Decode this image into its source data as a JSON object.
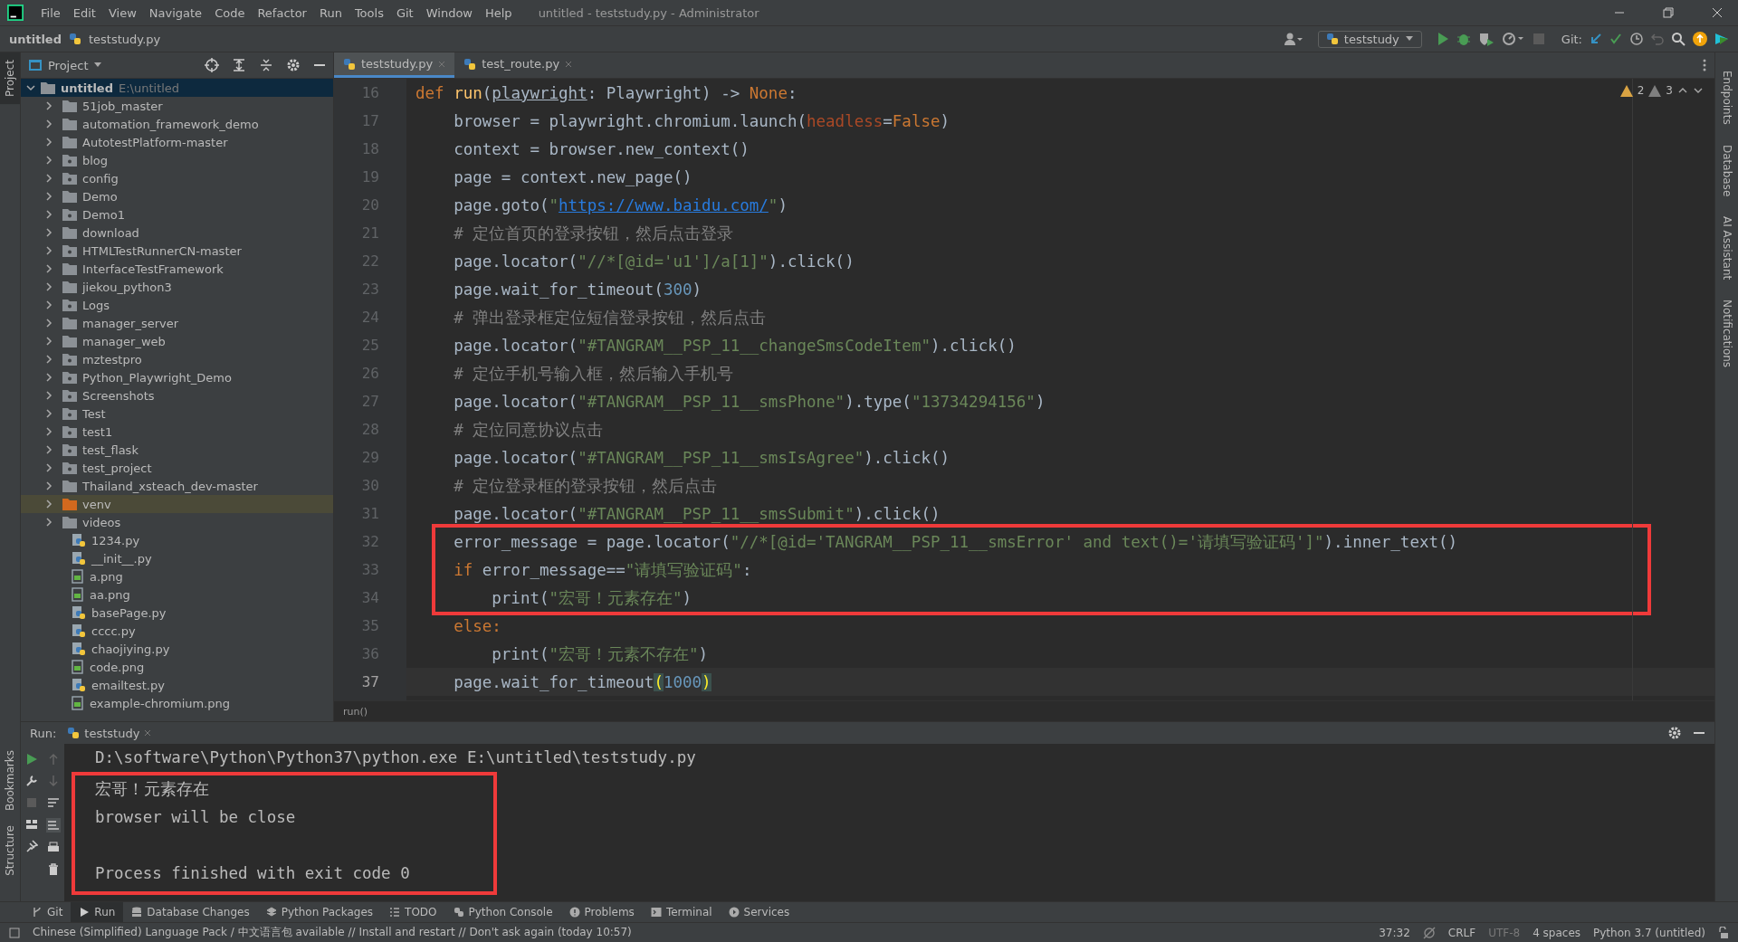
{
  "title_bar": {
    "menus": [
      "File",
      "Edit",
      "View",
      "Navigate",
      "Code",
      "Refactor",
      "Run",
      "Tools",
      "Git",
      "Window",
      "Help"
    ],
    "title": "untitled - teststudy.py - Administrator"
  },
  "nav_bar": {
    "breadcrumb": [
      "untitled",
      "teststudy.py"
    ],
    "run_config": "teststudy",
    "git_label": "Git:"
  },
  "left_stripe": {
    "top": [
      {
        "label": "Project",
        "selected": true
      }
    ],
    "bottom": [
      {
        "label": "Bookmarks",
        "selected": false
      },
      {
        "label": "Structure",
        "selected": false
      }
    ]
  },
  "project": {
    "title": "Project",
    "root": {
      "name": "untitled",
      "path": "E:\\untitled",
      "expanded": true,
      "children": [
        {
          "name": "51job_master",
          "kind": "folder",
          "expanded": false,
          "selected": false
        },
        {
          "name": "automation_framework_demo",
          "kind": "folder",
          "expanded": false,
          "selected": false
        },
        {
          "name": "AutotestPlatform-master",
          "kind": "folder",
          "expanded": false,
          "selected": false
        },
        {
          "name": "blog",
          "kind": "package",
          "expanded": false,
          "selected": false
        },
        {
          "name": "config",
          "kind": "package",
          "expanded": false,
          "selected": false
        },
        {
          "name": "Demo",
          "kind": "folder",
          "expanded": false,
          "selected": false
        },
        {
          "name": "Demo1",
          "kind": "package",
          "expanded": false,
          "selected": false
        },
        {
          "name": "download",
          "kind": "folder",
          "expanded": false,
          "selected": false
        },
        {
          "name": "HTMLTestRunnerCN-master",
          "kind": "package",
          "expanded": false,
          "selected": false
        },
        {
          "name": "InterfaceTestFramework",
          "kind": "folder",
          "expanded": false,
          "selected": false
        },
        {
          "name": "jiekou_python3",
          "kind": "folder",
          "expanded": false,
          "selected": false
        },
        {
          "name": "Logs",
          "kind": "package",
          "expanded": false,
          "selected": false
        },
        {
          "name": "manager_server",
          "kind": "folder",
          "expanded": false,
          "selected": false
        },
        {
          "name": "manager_web",
          "kind": "folder",
          "expanded": false,
          "selected": false
        },
        {
          "name": "mztestpro",
          "kind": "package",
          "expanded": false,
          "selected": false
        },
        {
          "name": "Python_Playwright_Demo",
          "kind": "package",
          "expanded": false,
          "selected": false
        },
        {
          "name": "Screenshots",
          "kind": "package",
          "expanded": false,
          "selected": false
        },
        {
          "name": "Test",
          "kind": "package",
          "expanded": false,
          "selected": false
        },
        {
          "name": "test1",
          "kind": "package",
          "expanded": false,
          "selected": false
        },
        {
          "name": "test_flask",
          "kind": "package",
          "expanded": false,
          "selected": false
        },
        {
          "name": "test_project",
          "kind": "package",
          "expanded": false,
          "selected": false
        },
        {
          "name": "Thailand_xsteach_dev-master",
          "kind": "folder",
          "expanded": false,
          "selected": false
        },
        {
          "name": "venv",
          "kind": "excluded",
          "expanded": false,
          "selected": true
        },
        {
          "name": "videos",
          "kind": "folder",
          "expanded": false,
          "selected": false
        },
        {
          "name": "1234.py",
          "kind": "python",
          "selected": false
        },
        {
          "name": "__init__.py",
          "kind": "python",
          "selected": false
        },
        {
          "name": "a.png",
          "kind": "image",
          "selected": false
        },
        {
          "name": "aa.png",
          "kind": "image",
          "selected": false
        },
        {
          "name": "basePage.py",
          "kind": "python",
          "selected": false
        },
        {
          "name": "cccc.py",
          "kind": "python",
          "selected": false
        },
        {
          "name": "chaojiying.py",
          "kind": "python",
          "selected": false
        },
        {
          "name": "code.png",
          "kind": "image",
          "selected": false
        },
        {
          "name": "emailtest.py",
          "kind": "python",
          "selected": false
        },
        {
          "name": "example-chromium.png",
          "kind": "image",
          "selected": false
        }
      ]
    }
  },
  "editor": {
    "tabs": [
      {
        "label": "teststudy.py",
        "selected": true
      },
      {
        "label": "test_route.py",
        "selected": false
      }
    ],
    "inspections": {
      "warnings": "2",
      "weak_warnings": "3"
    },
    "blocks": [
      {
        "boxed": false,
        "lines": [
          {
            "num": "16",
            "current": false,
            "tokens": [
              {
                "text": "def ",
                "kind": "keyword"
              },
              {
                "text": "run",
                "kind": "function"
              },
              {
                "text": "(",
                "kind": "plain"
              },
              {
                "text": "playwright",
                "kind": "underlined"
              },
              {
                "text": ": Playwright) -> ",
                "kind": "plain"
              },
              {
                "text": "None",
                "kind": "keyword"
              },
              {
                "text": ":",
                "kind": "plain"
              }
            ]
          },
          {
            "num": "17",
            "current": false,
            "tokens": [
              {
                "text": "    browser = playwright.chromium.launch(",
                "kind": "plain"
              },
              {
                "text": "headless",
                "kind": "argument"
              },
              {
                "text": "=",
                "kind": "plain"
              },
              {
                "text": "False",
                "kind": "keyword"
              },
              {
                "text": ")",
                "kind": "plain"
              }
            ]
          },
          {
            "num": "18",
            "current": false,
            "tokens": [
              {
                "text": "    context = browser.new_context()",
                "kind": "plain"
              }
            ]
          },
          {
            "num": "19",
            "current": false,
            "tokens": [
              {
                "text": "    page = context.new_page()",
                "kind": "plain"
              }
            ]
          },
          {
            "num": "20",
            "current": false,
            "tokens": [
              {
                "text": "    page.goto(",
                "kind": "plain"
              },
              {
                "text": "\"",
                "kind": "string"
              },
              {
                "text": "https://www.baidu.com/",
                "kind": "link"
              },
              {
                "text": "\"",
                "kind": "string"
              },
              {
                "text": ")",
                "kind": "plain"
              }
            ]
          },
          {
            "num": "21",
            "current": false,
            "tokens": [
              {
                "text": "    # 定位首页的登录按钮，然后点击登录",
                "kind": "comment"
              }
            ]
          },
          {
            "num": "22",
            "current": false,
            "tokens": [
              {
                "text": "    page.locator(",
                "kind": "plain"
              },
              {
                "text": "\"//*[@id='u1']/a[1]\"",
                "kind": "string"
              },
              {
                "text": ").click()",
                "kind": "plain"
              }
            ]
          },
          {
            "num": "23",
            "current": false,
            "tokens": [
              {
                "text": "    page.wait_for_timeout(",
                "kind": "plain"
              },
              {
                "text": "300",
                "kind": "number"
              },
              {
                "text": ")",
                "kind": "plain"
              }
            ]
          },
          {
            "num": "24",
            "current": false,
            "tokens": [
              {
                "text": "    # 弹出登录框定位短信登录按钮，然后点击",
                "kind": "comment"
              }
            ]
          },
          {
            "num": "25",
            "current": false,
            "tokens": [
              {
                "text": "    page.locator(",
                "kind": "plain"
              },
              {
                "text": "\"#TANGRAM__PSP_11__changeSmsCodeItem\"",
                "kind": "string"
              },
              {
                "text": ").click()",
                "kind": "plain"
              }
            ]
          },
          {
            "num": "26",
            "current": false,
            "tokens": [
              {
                "text": "    # 定位手机号输入框，然后输入手机号",
                "kind": "comment"
              }
            ]
          },
          {
            "num": "27",
            "current": false,
            "tokens": [
              {
                "text": "    page.locator(",
                "kind": "plain"
              },
              {
                "text": "\"#TANGRAM__PSP_11__smsPhone\"",
                "kind": "string"
              },
              {
                "text": ").type(",
                "kind": "plain"
              },
              {
                "text": "\"13734294156\"",
                "kind": "string"
              },
              {
                "text": ")",
                "kind": "plain"
              }
            ]
          },
          {
            "num": "28",
            "current": false,
            "tokens": [
              {
                "text": "    # 定位同意协议点击",
                "kind": "comment"
              }
            ]
          },
          {
            "num": "29",
            "current": false,
            "tokens": [
              {
                "text": "    page.locator(",
                "kind": "plain"
              },
              {
                "text": "\"#TANGRAM__PSP_11__smsIsAgree\"",
                "kind": "string"
              },
              {
                "text": ").click()",
                "kind": "plain"
              }
            ]
          },
          {
            "num": "30",
            "current": false,
            "tokens": [
              {
                "text": "    # 定位登录框的登录按钮，然后点击",
                "kind": "comment"
              }
            ]
          },
          {
            "num": "31",
            "current": false,
            "tokens": [
              {
                "text": "    page.locator(",
                "kind": "plain"
              },
              {
                "text": "\"#TANGRAM__PSP_11__smsSubmit\"",
                "kind": "string"
              },
              {
                "text": ").click()",
                "kind": "plain"
              }
            ]
          }
        ]
      },
      {
        "boxed": true,
        "lines": [
          {
            "num": "32",
            "current": false,
            "tokens": [
              {
                "text": "    error_message = page.locator(",
                "kind": "plain"
              },
              {
                "text": "\"//*[@id='TANGRAM__PSP_11__smsError' and text()='请填写验证码']\"",
                "kind": "string"
              },
              {
                "text": ").inner_text()",
                "kind": "plain"
              }
            ]
          },
          {
            "num": "33",
            "current": false,
            "tokens": [
              {
                "text": "    if",
                "kind": "keyword"
              },
              {
                "text": " error_message==",
                "kind": "plain"
              },
              {
                "text": "\"请填写验证码\"",
                "kind": "string"
              },
              {
                "text": ":",
                "kind": "plain"
              }
            ]
          },
          {
            "num": "34",
            "current": false,
            "tokens": [
              {
                "text": "        print(",
                "kind": "plain"
              },
              {
                "text": "\"宏哥！元素存在\"",
                "kind": "string"
              },
              {
                "text": ")",
                "kind": "plain"
              }
            ]
          }
        ]
      },
      {
        "boxed": false,
        "lines": [
          {
            "num": "35",
            "current": false,
            "tokens": [
              {
                "text": "    else:",
                "kind": "keyword"
              }
            ]
          },
          {
            "num": "36",
            "current": false,
            "tokens": [
              {
                "text": "        print(",
                "kind": "plain"
              },
              {
                "text": "\"宏哥！元素不存在\"",
                "kind": "string"
              },
              {
                "text": ")",
                "kind": "plain"
              }
            ]
          },
          {
            "num": "37",
            "current": true,
            "tokens": [
              {
                "text": "    page.wait_for_timeout",
                "kind": "plain"
              },
              {
                "text": "(",
                "kind": "brace"
              },
              {
                "text": "1000",
                "kind": "number"
              },
              {
                "text": ")",
                "kind": "brace"
              }
            ]
          }
        ]
      }
    ],
    "breadcrumb": "run()"
  },
  "right_stripe": [
    "Endpoints",
    "Database",
    "AI Assistant",
    "Notifications"
  ],
  "run": {
    "label": "Run:",
    "tab": "teststudy",
    "command": "D:\\software\\Python\\Python37\\python.exe E:\\untitled\\teststudy.py",
    "boxed_output": [
      [
        "宏哥！元素存在",
        "browser will be close"
      ],
      [
        "Process finished with exit code 0"
      ]
    ]
  },
  "tool_buttons": [
    {
      "label": "Git",
      "selected": false,
      "kind": "branch"
    },
    {
      "label": "Run",
      "selected": true,
      "kind": "play"
    },
    {
      "label": "Database Changes",
      "selected": false,
      "kind": "database"
    },
    {
      "label": "Python Packages",
      "selected": false,
      "kind": "layers"
    },
    {
      "label": "TODO",
      "selected": false,
      "kind": "list"
    },
    {
      "label": "Python Console",
      "selected": false,
      "kind": "python"
    },
    {
      "label": "Problems",
      "selected": false,
      "kind": "info"
    },
    {
      "label": "Terminal",
      "selected": false,
      "kind": "terminal"
    },
    {
      "label": "Services",
      "selected": false,
      "kind": "services"
    }
  ],
  "status_bar": {
    "message": "Chinese (Simplified) Language Pack / 中文语言包 available // Install and restart // Don't ask again (today 10:57)",
    "position": "37:32",
    "line_separator": "CRLF",
    "encoding": "UTF-8",
    "indent": "4 spaces",
    "interpreter": "Python 3.7 (untitled)"
  }
}
